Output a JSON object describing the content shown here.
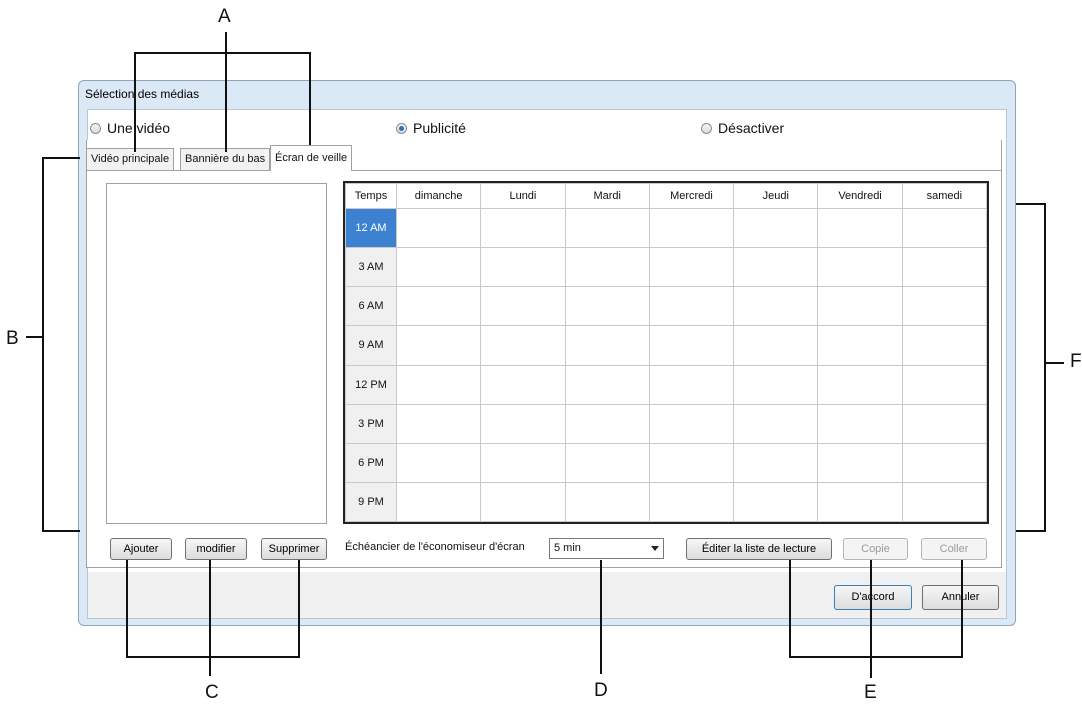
{
  "window": {
    "title": "Sélection des médias"
  },
  "mode_radios": [
    {
      "label": "Une vidéo",
      "checked": false
    },
    {
      "label": "Publicité",
      "checked": true
    },
    {
      "label": "Désactiver",
      "checked": false
    }
  ],
  "tabs": [
    {
      "label": "Vidéo principale",
      "active": false
    },
    {
      "label": "Bannière du bas",
      "active": false
    },
    {
      "label": "Écran de veille",
      "active": true
    }
  ],
  "schedule": {
    "columns": [
      "Temps",
      "dimanche",
      "Lundi",
      "Mardi",
      "Mercredi",
      "Jeudi",
      "Vendredi",
      "samedi"
    ],
    "rows": [
      "12 AM",
      "3 AM",
      "6 AM",
      "9 AM",
      "12 PM",
      "3 PM",
      "6 PM",
      "9 PM"
    ],
    "selected_row": "12 AM"
  },
  "list_buttons": {
    "add": "Ajouter",
    "edit": "modifier",
    "delete": "Supprimer"
  },
  "screensaver": {
    "label": "Échéancier de l'économiseur d'écran",
    "interval_value": "5 min"
  },
  "playlist_buttons": {
    "edit_playlist": "Éditer la liste de lecture",
    "copy": "Copie",
    "paste": "Coller"
  },
  "dialog_buttons": {
    "ok": "D'accord",
    "cancel": "Annuler"
  },
  "callouts": {
    "a": "A",
    "b": "B",
    "c": "C",
    "d": "D",
    "e": "E",
    "f": "F"
  }
}
